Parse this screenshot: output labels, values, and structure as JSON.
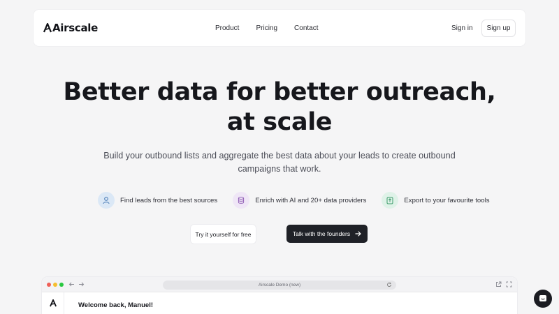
{
  "brand": {
    "name": "Airscale"
  },
  "nav": {
    "links": [
      "Product",
      "Pricing",
      "Contact"
    ],
    "sign_in": "Sign in",
    "sign_up": "Sign up"
  },
  "hero": {
    "title_line1": "Better data for better outreach,",
    "title_line2": "at scale",
    "subtitle": "Build your outbound lists and aggregate the best data about your leads to create outbound campaigns that work."
  },
  "features": [
    {
      "label": "Find leads from the best sources",
      "icon": "user-icon",
      "color": "#dbe8f6"
    },
    {
      "label": "Enrich with AI and 20+ data providers",
      "icon": "database-icon",
      "color": "#efe6f6"
    },
    {
      "label": "Export to your favourite tools",
      "icon": "export-icon",
      "color": "#dff2e8"
    }
  ],
  "cta": {
    "try_label": "Try it yourself for free",
    "talk_label": "Talk with the founders"
  },
  "demo": {
    "url_title": "Airscale Demo (new)",
    "welcome": "Welcome back, Manuel!"
  },
  "colors": {
    "background": "#f5f5f6",
    "dark_button": "#1f2127",
    "traffic_red": "#ef5f57",
    "traffic_yellow": "#f5bd2f",
    "traffic_green": "#29c840"
  }
}
